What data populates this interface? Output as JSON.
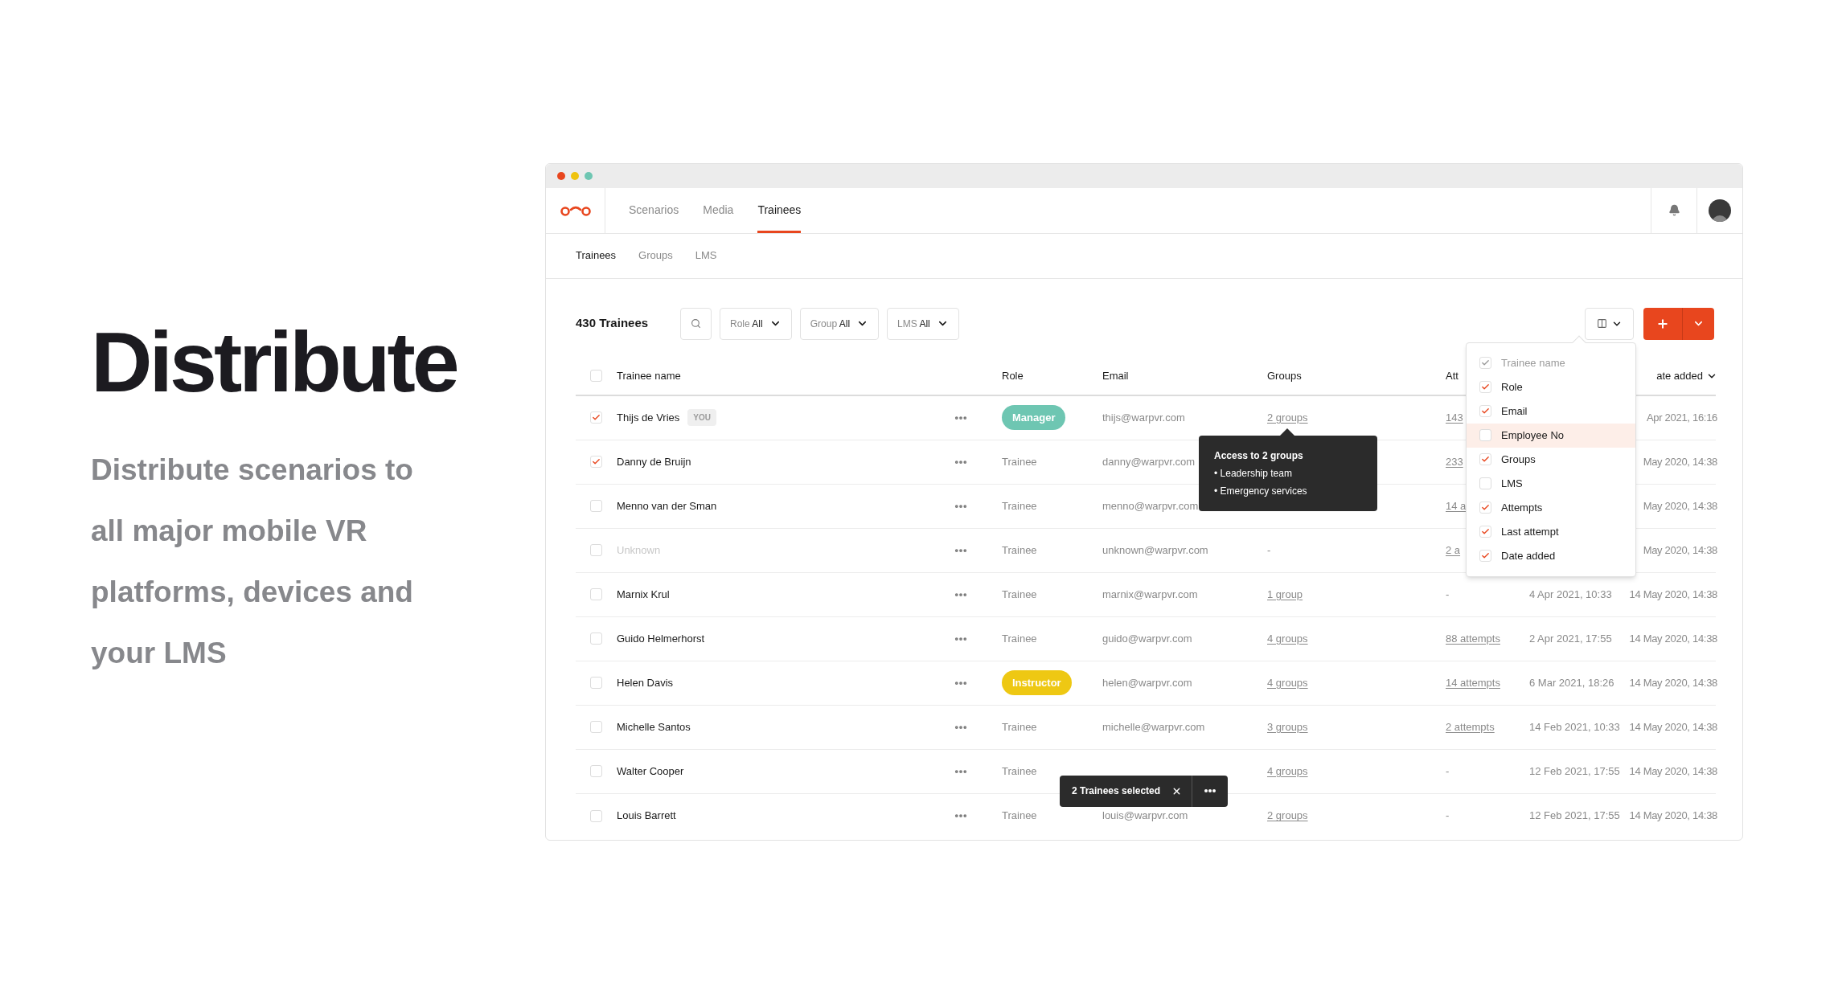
{
  "hero": {
    "title": "Distribute",
    "text": "Distribute scenarios to all major mobile VR platforms, devices and your LMS"
  },
  "nav": {
    "tabs": [
      {
        "label": "Scenarios",
        "selected": false
      },
      {
        "label": "Media",
        "selected": false
      },
      {
        "label": "Trainees",
        "selected": true
      }
    ]
  },
  "subnav": {
    "tabs": [
      {
        "label": "Trainees",
        "selected": true
      },
      {
        "label": "Groups",
        "selected": false
      },
      {
        "label": "LMS",
        "selected": false
      }
    ]
  },
  "toolbar": {
    "count": "430 Trainees",
    "filters": [
      {
        "label": "Role",
        "value": "All"
      },
      {
        "label": "Group",
        "value": "All"
      },
      {
        "label": "LMS",
        "value": "All"
      }
    ]
  },
  "table": {
    "columns": [
      "Trainee name",
      "Role",
      "Email",
      "Groups",
      "Att",
      "ate added"
    ],
    "select_all": {
      "checked": false
    },
    "rows": [
      {
        "checked": true,
        "disabled": false,
        "name": "Thijs de Vries",
        "badge": "YOU",
        "role": {
          "label": "Manager",
          "kind": "badge",
          "color": "#6ec6b2"
        },
        "email": "thijs@warpvr.com",
        "groups": {
          "text": "2 groups",
          "link": true
        },
        "attempts": {
          "text": "143",
          "link": true
        },
        "date_added": "Apr 2021, 16:16"
      },
      {
        "checked": true,
        "disabled": false,
        "name": "Danny de Bruijn",
        "role": {
          "label": "Trainee",
          "kind": "text"
        },
        "email": "danny@warpvr.com",
        "attempts": {
          "text": "233",
          "link": true
        },
        "date_added": "May 2020, 14:38"
      },
      {
        "checked": false,
        "disabled": false,
        "name": "Menno van der Sman",
        "role": {
          "label": "Trainee",
          "kind": "text"
        },
        "email": "menno@warpvr.com",
        "attempts": {
          "text": "14 a",
          "link": true
        },
        "date_added": "May 2020, 14:38"
      },
      {
        "checked": false,
        "disabled": true,
        "name": "Unknown",
        "role": {
          "label": "Trainee",
          "kind": "text"
        },
        "email": "unknown@warpvr.com",
        "groups": {
          "text": "-",
          "link": false
        },
        "attempts": {
          "text": "2 a",
          "link": true
        },
        "date_added": "May 2020, 14:38"
      },
      {
        "checked": false,
        "disabled": false,
        "name": "Marnix Krul",
        "role": {
          "label": "Trainee",
          "kind": "text"
        },
        "email": "marnix@warpvr.com",
        "groups": {
          "text": "1 group",
          "link": true
        },
        "attempts": {
          "text": "-",
          "link": false
        },
        "last_attempt": "4 Apr 2021, 10:33",
        "date_added": "14 May 2020, 14:38"
      },
      {
        "checked": false,
        "disabled": false,
        "name": "Guido Helmerhorst",
        "role": {
          "label": "Trainee",
          "kind": "text"
        },
        "email": "guido@warpvr.com",
        "groups": {
          "text": "4 groups",
          "link": true
        },
        "attempts": {
          "text": "88 attempts",
          "link": true
        },
        "last_attempt": "2 Apr 2021, 17:55",
        "date_added": "14 May 2020, 14:38"
      },
      {
        "checked": false,
        "disabled": false,
        "name": "Helen Davis",
        "role": {
          "label": "Instructor",
          "kind": "badge",
          "color": "#eec813"
        },
        "email": "helen@warpvr.com",
        "groups": {
          "text": "4 groups",
          "link": true
        },
        "attempts": {
          "text": "14 attempts",
          "link": true
        },
        "last_attempt": "6 Mar 2021, 18:26",
        "date_added": "14 May 2020, 14:38"
      },
      {
        "checked": false,
        "disabled": false,
        "name": "Michelle Santos",
        "role": {
          "label": "Trainee",
          "kind": "text"
        },
        "email": "michelle@warpvr.com",
        "groups": {
          "text": "3 groups",
          "link": true
        },
        "attempts": {
          "text": "2 attempts",
          "link": true
        },
        "last_attempt": "14 Feb 2021, 10:33",
        "date_added": "14 May 2020, 14:38"
      },
      {
        "checked": false,
        "disabled": false,
        "name": "Walter Cooper",
        "role": {
          "label": "Trainee",
          "kind": "text"
        },
        "groups": {
          "text": "4 groups",
          "link": true
        },
        "attempts": {
          "text": "-",
          "link": false
        },
        "last_attempt": "12 Feb 2021, 17:55",
        "date_added": "14 May 2020, 14:38"
      },
      {
        "checked": false,
        "disabled": false,
        "name": "Louis Barrett",
        "role": {
          "label": "Trainee",
          "kind": "text"
        },
        "email": "louis@warpvr.com",
        "groups": {
          "text": "2 groups",
          "link": true
        },
        "attempts": {
          "text": "-",
          "link": false
        },
        "last_attempt": "12 Feb 2021, 17:55",
        "date_added": "14 May 2020, 14:38"
      }
    ]
  },
  "column_menu": {
    "items": [
      {
        "label": "Trainee name",
        "checked": true,
        "disabled": true,
        "highlighted": false
      },
      {
        "label": "Role",
        "checked": true,
        "disabled": false,
        "highlighted": false
      },
      {
        "label": "Email",
        "checked": true,
        "disabled": false,
        "highlighted": false
      },
      {
        "label": "Employee No",
        "checked": false,
        "disabled": false,
        "highlighted": true
      },
      {
        "label": "Groups",
        "checked": true,
        "disabled": false,
        "highlighted": false
      },
      {
        "label": "LMS",
        "checked": false,
        "disabled": false,
        "highlighted": false
      },
      {
        "label": "Attempts",
        "checked": true,
        "disabled": false,
        "highlighted": false
      },
      {
        "label": "Last attempt",
        "checked": true,
        "disabled": false,
        "highlighted": false
      },
      {
        "label": "Date added",
        "checked": true,
        "disabled": false,
        "highlighted": false
      }
    ]
  },
  "tooltip": {
    "title": "Access to 2 groups",
    "items": [
      "• Leadership team",
      "• Emergency services"
    ]
  },
  "selection_bar": {
    "text": "2 Trainees selected"
  }
}
